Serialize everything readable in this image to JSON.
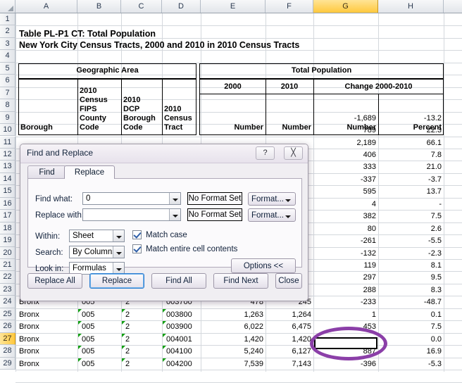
{
  "app": {
    "name": "Microsoft Excel",
    "corner_select_all": "select-all"
  },
  "grid": {
    "columns": [
      "A",
      "B",
      "C",
      "D",
      "E",
      "F",
      "H"
    ],
    "selected_column": "G",
    "rows": [
      "1",
      "2",
      "3",
      "4",
      "5",
      "6",
      "7",
      "8",
      "9",
      "10",
      "11",
      "12",
      "13",
      "14",
      "15",
      "16",
      "17",
      "18",
      "19",
      "20",
      "21",
      "22",
      "23",
      "24",
      "25",
      "26",
      "27",
      "28",
      "29"
    ],
    "selected_row": "27",
    "active_cell": "G27"
  },
  "titles": {
    "line1": "Table PL-P1 CT:  Total Population",
    "line2": "New York City Census Tracts, 2000 and 2010 in 2010 Census Tracts"
  },
  "table_header": {
    "group_left": "Geographic Area",
    "group_right": "Total Population",
    "year_2000": "2000",
    "year_2010": "2010",
    "change_label": "Change 2000-2010",
    "col_borough": "Borough",
    "col_fips": "2010 Census FIPS County Code",
    "col_fips_lines": [
      "2010",
      "Census",
      "FIPS",
      "County",
      "Code"
    ],
    "col_dcp": "2010 DCP Borough Code",
    "col_dcp_lines": [
      "2010",
      "DCP",
      "Borough",
      "Code"
    ],
    "col_tract": "2010 Census Tract",
    "col_tract_lines": [
      "2010",
      "Census",
      "Tract"
    ],
    "col_number_2000": "Number",
    "col_number_2010": "Number",
    "col_change_number": "Number",
    "col_change_percent": "Percent"
  },
  "hidden_rows_values": [
    {
      "row": "9",
      "g": "-1,689",
      "h": "-13.2"
    },
    {
      "row": "10",
      "g": "789",
      "h": "22.3"
    },
    {
      "row": "11",
      "g": "2,189",
      "h": "66.1"
    },
    {
      "row": "12",
      "g": "406",
      "h": "7.8"
    },
    {
      "row": "13",
      "g": "333",
      "h": "21.0"
    },
    {
      "row": "14",
      "g": "-337",
      "h": "-3.7"
    },
    {
      "row": "15",
      "g": "595",
      "h": "13.7"
    },
    {
      "row": "16",
      "g": "4",
      "h": "-"
    },
    {
      "row": "17",
      "g": "382",
      "h": "7.5"
    },
    {
      "row": "18",
      "g": "80",
      "h": "2.6"
    },
    {
      "row": "19",
      "g": "-261",
      "h": "-5.5"
    },
    {
      "row": "20",
      "g": "-132",
      "h": "-2.3"
    },
    {
      "row": "21",
      "g": "119",
      "h": "8.1"
    },
    {
      "row": "22",
      "g": "297",
      "h": "9.5"
    },
    {
      "row": "23",
      "g": "288",
      "h": "8.3"
    }
  ],
  "data_rows": [
    {
      "row": "24",
      "borough": "Bronx",
      "fips": "005",
      "dcp": "2",
      "tract": "003700",
      "pop2000": "478",
      "pop2010": "245",
      "change": "-233",
      "percent": "-48.7"
    },
    {
      "row": "25",
      "borough": "Bronx",
      "fips": "005",
      "dcp": "2",
      "tract": "003800",
      "pop2000": "1,263",
      "pop2010": "1,264",
      "change": "1",
      "percent": "0.1"
    },
    {
      "row": "26",
      "borough": "Bronx",
      "fips": "005",
      "dcp": "2",
      "tract": "003900",
      "pop2000": "6,022",
      "pop2010": "6,475",
      "change": "453",
      "percent": "7.5"
    },
    {
      "row": "27",
      "borough": "Bronx",
      "fips": "005",
      "dcp": "2",
      "tract": "004001",
      "pop2000": "1,420",
      "pop2010": "1,420",
      "change": "",
      "percent": "0.0"
    },
    {
      "row": "28",
      "borough": "Bronx",
      "fips": "005",
      "dcp": "2",
      "tract": "004100",
      "pop2000": "5,240",
      "pop2010": "6,127",
      "change": "887",
      "percent": "16.9"
    },
    {
      "row": "29",
      "borough": "Bronx",
      "fips": "005",
      "dcp": "2",
      "tract": "004200",
      "pop2000": "7,539",
      "pop2010": "7,143",
      "change": "-396",
      "percent": "-5.3"
    }
  ],
  "annotation": {
    "shape": "ellipse",
    "color": "#8B3FA8",
    "target_cell": "G27"
  },
  "dialog": {
    "title": "Find and Replace",
    "help_icon": "?",
    "close_icon": "╳",
    "tabs": [
      {
        "label": "Find",
        "active": false
      },
      {
        "label": "Replace",
        "active": true
      }
    ],
    "find_what_label": "Find what:",
    "find_what_value": "0",
    "replace_with_label": "Replace with:",
    "replace_with_value": "",
    "no_format_set_1": "No Format Set",
    "no_format_set_2": "No Format Set",
    "format_button_1": "Format...",
    "format_button_2": "Format...",
    "within_label": "Within:",
    "within_value": "Sheet",
    "search_label": "Search:",
    "search_value": "By Columns",
    "lookin_label": "Look in:",
    "lookin_value": "Formulas",
    "match_case_label": "Match case",
    "match_case_checked": true,
    "match_entire_label": "Match entire cell contents",
    "match_entire_checked": true,
    "options_button": "Options <<",
    "buttons": [
      {
        "label": "Replace All",
        "focus": false
      },
      {
        "label": "Replace",
        "focus": true
      },
      {
        "label": "Find All",
        "focus": false
      },
      {
        "label": "Find Next",
        "focus": false
      },
      {
        "label": "Close",
        "focus": false
      }
    ]
  }
}
